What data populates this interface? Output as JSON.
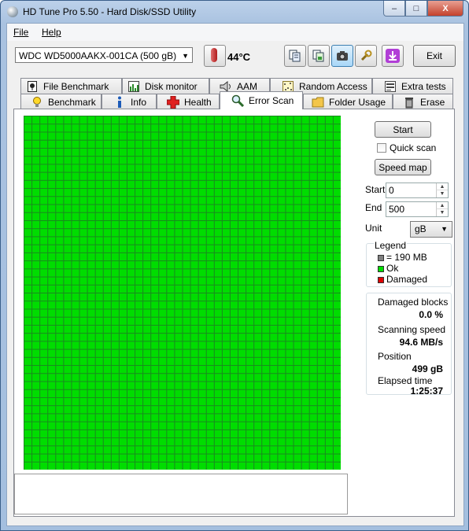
{
  "window": {
    "title": "HD Tune Pro 5.50 - Hard Disk/SSD Utility",
    "controls": {
      "minimize": "–",
      "maximize": "□",
      "close": "X"
    }
  },
  "menu": {
    "file": "File",
    "help": "Help"
  },
  "toolbar": {
    "drive": "WDC    WD5000AAKX-001CA (500 gB)",
    "temperature": "44",
    "temperature_unit": "°C",
    "exit_label": "Exit"
  },
  "tabs_top": [
    {
      "label": "File Benchmark",
      "icon": "file-benchmark-icon"
    },
    {
      "label": "Disk monitor",
      "icon": "disk-monitor-icon"
    },
    {
      "label": "AAM",
      "icon": "speaker-icon"
    },
    {
      "label": "Random Access",
      "icon": "random-access-icon"
    },
    {
      "label": "Extra tests",
      "icon": "extra-tests-icon"
    }
  ],
  "tabs_bottom": [
    {
      "label": "Benchmark",
      "icon": "lightbulb-icon"
    },
    {
      "label": "Info",
      "icon": "info-icon"
    },
    {
      "label": "Health",
      "icon": "health-cross-icon"
    },
    {
      "label": "Error Scan",
      "icon": "magnifier-icon",
      "active": true
    },
    {
      "label": "Folder Usage",
      "icon": "folder-icon"
    },
    {
      "label": "Erase",
      "icon": "trash-icon"
    }
  ],
  "scan": {
    "grid_columns": 40,
    "grid_rows": 44,
    "block_color_ok": "#00dd00",
    "grid_line_color": "#1a8a1f"
  },
  "controls": {
    "start_button": "Start",
    "quick_scan_label": "Quick scan",
    "quick_scan_checked": false,
    "speed_map_button": "Speed map",
    "start_label": "Start",
    "start_value": "0",
    "end_label": "End",
    "end_value": "500",
    "unit_label": "Unit",
    "unit_value": "gB"
  },
  "legend": {
    "title": "Legend",
    "block_size": "= 190 MB",
    "ok": "Ok",
    "damaged": "Damaged",
    "colors": {
      "block": "#808080",
      "ok": "#00dd00",
      "damaged": "#e00000"
    }
  },
  "stats": {
    "damaged_blocks_label": "Damaged blocks",
    "damaged_blocks_value": "0.0 %",
    "scanning_speed_label": "Scanning speed",
    "scanning_speed_value": "94.6 MB/s",
    "position_label": "Position",
    "position_value": "499 gB",
    "elapsed_time_label": "Elapsed time",
    "elapsed_time_value": "1:25:37"
  }
}
